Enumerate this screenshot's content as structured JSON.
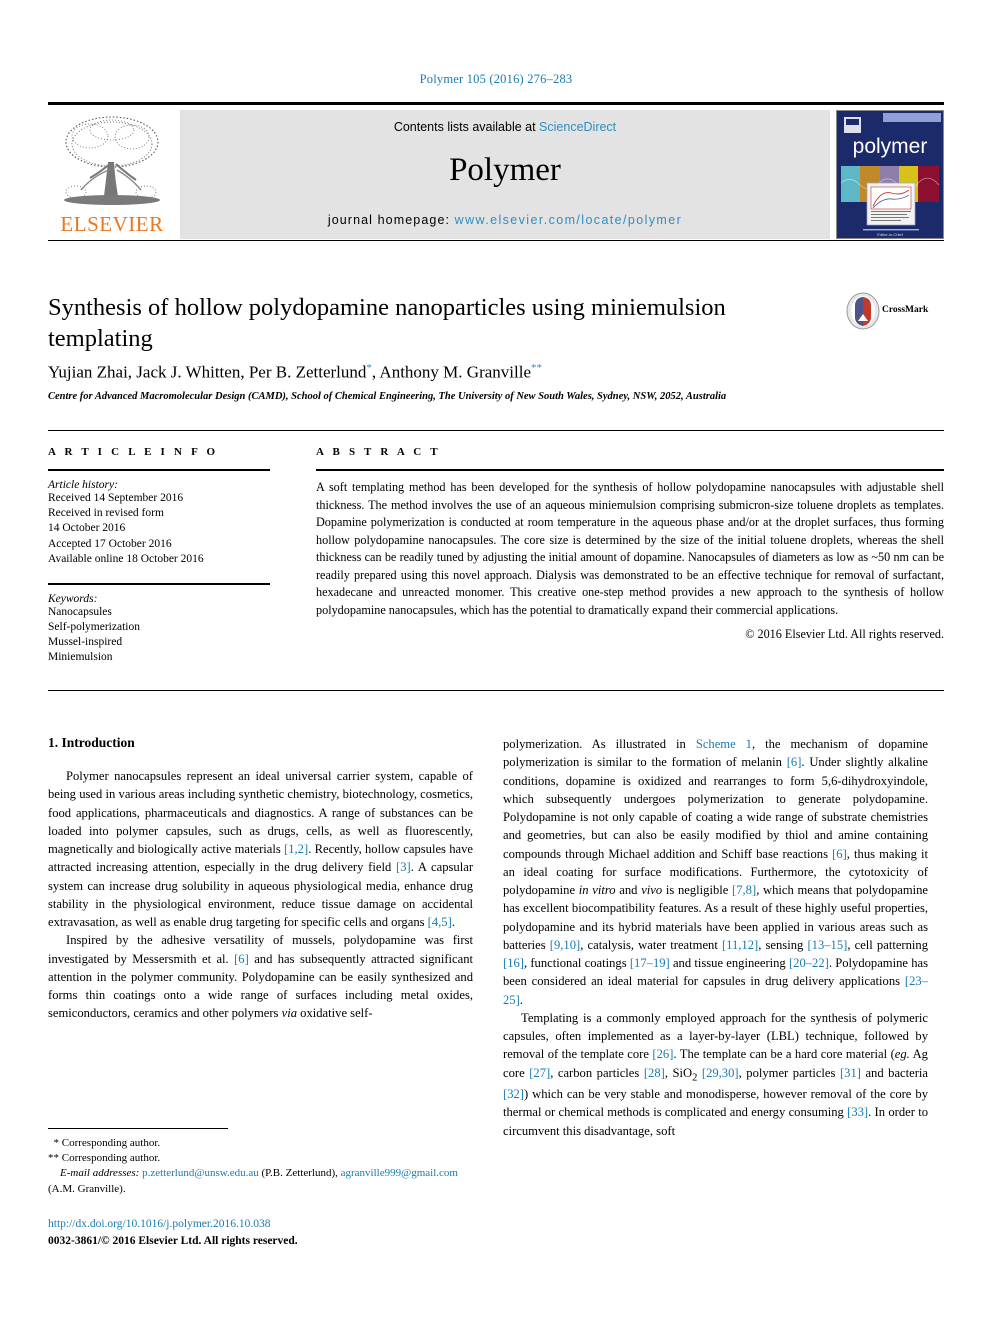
{
  "running_head": "Polymer 105 (2016) 276–283",
  "masthead": {
    "publisher_name": "ELSEVIER",
    "contents_prefix": "Contents lists available at ",
    "contents_link": "ScienceDirect",
    "journal_name": "Polymer",
    "homepage_label": "journal homepage: ",
    "homepage_url": "www.elsevier.com/locate/polymer",
    "cover_title": "polymer"
  },
  "article": {
    "title": "Synthesis of hollow polydopamine nanoparticles using miniemulsion templating",
    "crossmark_label": "CrossMark",
    "authors_html": "Yujian Zhai, Jack J. Whitten, Per B. Zetterlund<sup>*</sup>, Anthony M. Granville<sup>**</sup>",
    "affiliation": "Centre for Advanced Macromolecular Design (CAMD), School of Chemical Engineering, The University of New South Wales, Sydney, NSW, 2052, Australia"
  },
  "article_info": {
    "heading": "A R T I C L E  I N F O",
    "history_label": "Article history:",
    "history": [
      "Received 14 September 2016",
      "Received in revised form",
      "14 October 2016",
      "Accepted 17 October 2016",
      "Available online 18 October 2016"
    ],
    "keywords_label": "Keywords:",
    "keywords": [
      "Nanocapsules",
      "Self-polymerization",
      "Mussel-inspired",
      "Miniemulsion"
    ]
  },
  "abstract": {
    "heading": "A B S T R A C T",
    "text": "A soft templating method has been developed for the synthesis of hollow polydopamine nanocapsules with adjustable shell thickness. The method involves the use of an aqueous miniemulsion comprising submicron-size toluene droplets as templates. Dopamine polymerization is conducted at room temperature in the aqueous phase and/or at the droplet surfaces, thus forming hollow polydopamine nanocapsules. The core size is determined by the size of the initial toluene droplets, whereas the shell thickness can be readily tuned by adjusting the initial amount of dopamine. Nanocapsules of diameters as low as ~50 nm can be readily prepared using this novel approach. Dialysis was demonstrated to be an effective technique for removal of surfactant, hexadecane and unreacted monomer. This creative one-step method provides a new approach to the synthesis of hollow polydopamine nanocapsules, which has the potential to dramatically expand their commercial applications.",
    "copyright": "© 2016 Elsevier Ltd. All rights reserved."
  },
  "body": {
    "section_heading": "1. Introduction",
    "left_paragraphs": [
      "Polymer nanocapsules represent an ideal universal carrier system, capable of being used in various areas including synthetic chemistry, biotechnology, cosmetics, food applications, pharmaceuticals and diagnostics. A range of substances can be loaded into polymer capsules, such as drugs, cells, as well as fluorescently, magnetically and biologically active materials <span class=\"ref\">[1,2]</span>. Recently, hollow capsules have attracted increasing attention, especially in the drug delivery field <span class=\"ref\">[3]</span>. A capsular system can increase drug solubility in aqueous physiological media, enhance drug stability in the physiological environment, reduce tissue damage on accidental extravasation, as well as enable drug targeting for specific cells and organs <span class=\"ref\">[4,5]</span>.",
      "Inspired by the adhesive versatility of mussels, polydopamine was first investigated by Messersmith et al. <span class=\"ref\">[6]</span> and has subsequently attracted significant attention in the polymer community. Polydopamine can be easily synthesized and forms thin coatings onto a wide range of surfaces including metal oxides, semiconductors, ceramics and other polymers <i>via</i> oxidative self-"
    ],
    "right_paragraphs": [
      "polymerization. As illustrated in <span class=\"ref\">Scheme 1</span>, the mechanism of dopamine polymerization is similar to the formation of melanin <span class=\"ref\">[6]</span>. Under slightly alkaline conditions, dopamine is oxidized and rearranges to form 5,6-dihydroxyindole, which subsequently undergoes polymerization to generate polydopamine. Polydopamine is not only capable of coating a wide range of substrate chemistries and geometries, but can also be easily modified by thiol and amine containing compounds through Michael addition and Schiff base reactions <span class=\"ref\">[6]</span>, thus making it an ideal coating for surface modifications. Furthermore, the cytotoxicity of polydopamine <i>in vitro</i> and <i>vivo</i> is negligible <span class=\"ref\">[7,8]</span>, which means that polydopamine has excellent biocompatibility features. As a result of these highly useful properties, polydopamine and its hybrid materials have been applied in various areas such as batteries <span class=\"ref\">[9,10]</span>, catalysis, water treatment <span class=\"ref\">[11,12]</span>, sensing <span class=\"ref\">[13&ndash;15]</span>, cell patterning <span class=\"ref\">[16]</span>, functional coatings <span class=\"ref\">[17&ndash;19]</span> and tissue engineering <span class=\"ref\">[20&ndash;22]</span>. Polydopamine has been considered an ideal material for capsules in drug delivery applications <span class=\"ref\">[23&ndash;25]</span>.",
      "Templating is a commonly employed approach for the synthesis of polymeric capsules, often implemented as a layer-by-layer (LBL) technique, followed by removal of the template core <span class=\"ref\">[26]</span>. The template can be a hard core material (<i>eg.</i> Ag core <span class=\"ref\">[27]</span>, carbon particles <span class=\"ref\">[28]</span>, SiO<sub>2</sub> <span class=\"ref\">[29,30]</span>, polymer particles <span class=\"ref\">[31]</span> and bacteria <span class=\"ref\">[32]</span>) which can be very stable and monodisperse, however removal of the core by thermal or chemical methods is complicated and energy consuming <span class=\"ref\">[33]</span>. In order to circumvent this disadvantage, soft"
    ]
  },
  "footnotes": {
    "corresponding_single": "Corresponding author.",
    "corresponding_double": "Corresponding author.",
    "email_label": "E-mail addresses:",
    "email_1": "p.zetterlund@unsw.edu.au",
    "email_1_owner": "(P.B. Zetterlund),",
    "email_2": "agranville999@gmail.com",
    "email_2_owner": "(A.M. Granville).",
    "doi": "http://dx.doi.org/10.1016/j.polymer.2016.10.038",
    "issn_line": "0032-3861/© 2016 Elsevier Ltd. All rights reserved."
  },
  "colors": {
    "link_blue": "#1a7bb0",
    "sd_blue": "#2e8ec0",
    "elsevier_orange": "#e87722",
    "cover_navy": "#1b2a6b",
    "masthead_gray": "#e3e3e3"
  }
}
